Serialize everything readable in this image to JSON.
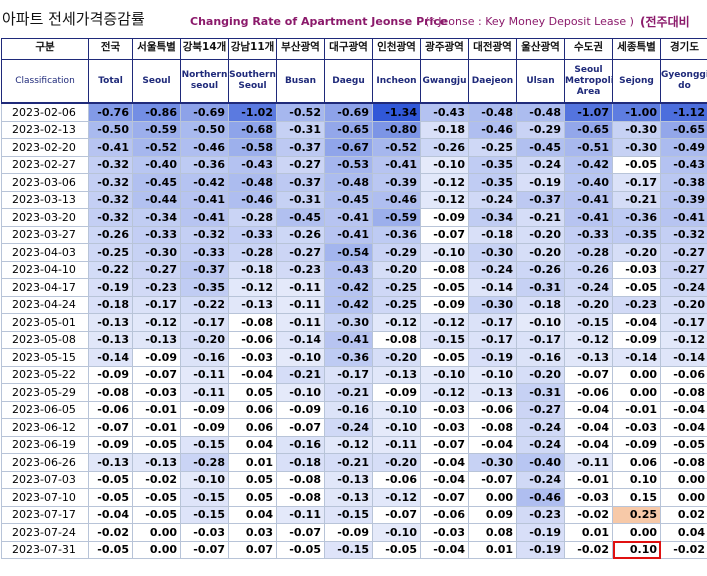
{
  "title": {
    "korean": "아파트 전세가격증감률",
    "english": "Changing Rate of Apartment Jeonse Price",
    "note": "(* Jeonse : Key Money Deposit Lease )",
    "comparison": "(전주대비"
  },
  "header": {
    "corner_korean": "구분",
    "corner_english": "Classification",
    "columns": [
      {
        "ko": "전국",
        "en": "Total"
      },
      {
        "ko": "서울특별",
        "en": "Seoul"
      },
      {
        "ko": "강북14개",
        "en": "Northern seoul"
      },
      {
        "ko": "강남11개",
        "en": "Southern Seoul"
      },
      {
        "ko": "부산광역",
        "en": "Busan"
      },
      {
        "ko": "대구광역",
        "en": "Daegu"
      },
      {
        "ko": "인천광역",
        "en": "Incheon"
      },
      {
        "ko": "광주광역",
        "en": "Gwangju"
      },
      {
        "ko": "대전광역",
        "en": "Daejeon"
      },
      {
        "ko": "울산광역",
        "en": "Ulsan"
      },
      {
        "ko": "수도권",
        "en": "Seoul Metropolitan Area"
      },
      {
        "ko": "세종특별",
        "en": "Sejong"
      },
      {
        "ko": "경기도",
        "en": "Gyeonggi-do"
      }
    ]
  },
  "colors": {
    "header_border": "#1f2a7a",
    "highlight_box": "#e01010",
    "positive_highlight": "#f7c9a8"
  },
  "rows": [
    {
      "date": "2023-02-06",
      "values": [
        "-0.76",
        "-0.86",
        "-0.69",
        "-1.02",
        "-0.52",
        "-0.69",
        "-1.34",
        "-0.43",
        "-0.48",
        "-0.48",
        "-1.07",
        "-1.00",
        "-1.12"
      ]
    },
    {
      "date": "2023-02-13",
      "values": [
        "-0.50",
        "-0.59",
        "-0.50",
        "-0.68",
        "-0.31",
        "-0.65",
        "-0.80",
        "-0.18",
        "-0.46",
        "-0.29",
        "-0.65",
        "-0.30",
        "-0.65"
      ]
    },
    {
      "date": "2023-02-20",
      "values": [
        "-0.41",
        "-0.52",
        "-0.46",
        "-0.58",
        "-0.37",
        "-0.67",
        "-0.52",
        "-0.26",
        "-0.25",
        "-0.45",
        "-0.51",
        "-0.30",
        "-0.49"
      ]
    },
    {
      "date": "2023-02-27",
      "values": [
        "-0.32",
        "-0.40",
        "-0.36",
        "-0.43",
        "-0.27",
        "-0.53",
        "-0.41",
        "-0.10",
        "-0.35",
        "-0.24",
        "-0.42",
        "-0.05",
        "-0.43"
      ]
    },
    {
      "date": "2023-03-06",
      "values": [
        "-0.32",
        "-0.45",
        "-0.42",
        "-0.48",
        "-0.37",
        "-0.48",
        "-0.39",
        "-0.12",
        "-0.35",
        "-0.19",
        "-0.40",
        "-0.17",
        "-0.38"
      ]
    },
    {
      "date": "2023-03-13",
      "values": [
        "-0.32",
        "-0.44",
        "-0.41",
        "-0.46",
        "-0.31",
        "-0.45",
        "-0.46",
        "-0.12",
        "-0.24",
        "-0.37",
        "-0.41",
        "-0.21",
        "-0.39"
      ]
    },
    {
      "date": "2023-03-20",
      "values": [
        "-0.32",
        "-0.34",
        "-0.41",
        "-0.28",
        "-0.45",
        "-0.41",
        "-0.59",
        "-0.09",
        "-0.34",
        "-0.21",
        "-0.41",
        "-0.36",
        "-0.41"
      ]
    },
    {
      "date": "2023-03-27",
      "values": [
        "-0.26",
        "-0.33",
        "-0.32",
        "-0.33",
        "-0.26",
        "-0.41",
        "-0.36",
        "-0.07",
        "-0.18",
        "-0.20",
        "-0.33",
        "-0.35",
        "-0.32"
      ]
    },
    {
      "date": "2023-04-03",
      "values": [
        "-0.25",
        "-0.30",
        "-0.33",
        "-0.28",
        "-0.27",
        "-0.54",
        "-0.29",
        "-0.10",
        "-0.30",
        "-0.20",
        "-0.28",
        "-0.20",
        "-0.27"
      ]
    },
    {
      "date": "2023-04-10",
      "values": [
        "-0.22",
        "-0.27",
        "-0.37",
        "-0.18",
        "-0.23",
        "-0.43",
        "-0.20",
        "-0.08",
        "-0.24",
        "-0.26",
        "-0.26",
        "-0.03",
        "-0.27"
      ]
    },
    {
      "date": "2023-04-17",
      "values": [
        "-0.19",
        "-0.23",
        "-0.35",
        "-0.12",
        "-0.11",
        "-0.42",
        "-0.25",
        "-0.05",
        "-0.14",
        "-0.31",
        "-0.24",
        "-0.05",
        "-0.24"
      ]
    },
    {
      "date": "2023-04-24",
      "values": [
        "-0.18",
        "-0.17",
        "-0.22",
        "-0.13",
        "-0.11",
        "-0.42",
        "-0.25",
        "-0.09",
        "-0.30",
        "-0.18",
        "-0.20",
        "-0.23",
        "-0.20"
      ]
    },
    {
      "date": "2023-05-01",
      "values": [
        "-0.13",
        "-0.12",
        "-0.17",
        "-0.08",
        "-0.11",
        "-0.30",
        "-0.12",
        "-0.12",
        "-0.17",
        "-0.10",
        "-0.15",
        "-0.04",
        "-0.17"
      ]
    },
    {
      "date": "2023-05-08",
      "values": [
        "-0.13",
        "-0.13",
        "-0.20",
        "-0.06",
        "-0.14",
        "-0.41",
        "-0.08",
        "-0.15",
        "-0.17",
        "-0.17",
        "-0.12",
        "-0.09",
        "-0.12"
      ]
    },
    {
      "date": "2023-05-15",
      "values": [
        "-0.14",
        "-0.09",
        "-0.16",
        "-0.03",
        "-0.10",
        "-0.36",
        "-0.20",
        "-0.05",
        "-0.19",
        "-0.16",
        "-0.13",
        "-0.14",
        "-0.14"
      ]
    },
    {
      "date": "2023-05-22",
      "values": [
        "-0.09",
        "-0.07",
        "-0.11",
        "-0.04",
        "-0.21",
        "-0.17",
        "-0.13",
        "-0.10",
        "-0.10",
        "-0.20",
        "-0.07",
        "0.00",
        "-0.06"
      ]
    },
    {
      "date": "2023-05-29",
      "values": [
        "-0.08",
        "-0.03",
        "-0.11",
        "0.05",
        "-0.10",
        "-0.21",
        "-0.09",
        "-0.12",
        "-0.13",
        "-0.31",
        "-0.06",
        "0.00",
        "-0.08"
      ]
    },
    {
      "date": "2023-06-05",
      "values": [
        "-0.06",
        "-0.01",
        "-0.09",
        "0.06",
        "-0.09",
        "-0.16",
        "-0.10",
        "-0.03",
        "-0.06",
        "-0.27",
        "-0.04",
        "-0.01",
        "-0.04"
      ]
    },
    {
      "date": "2023-06-12",
      "values": [
        "-0.07",
        "-0.01",
        "-0.09",
        "0.06",
        "-0.07",
        "-0.24",
        "-0.10",
        "-0.03",
        "-0.08",
        "-0.24",
        "-0.04",
        "-0.03",
        "-0.04"
      ]
    },
    {
      "date": "2023-06-19",
      "values": [
        "-0.09",
        "-0.05",
        "-0.15",
        "0.04",
        "-0.16",
        "-0.12",
        "-0.11",
        "-0.07",
        "-0.04",
        "-0.24",
        "-0.04",
        "-0.09",
        "-0.05"
      ]
    },
    {
      "date": "2023-06-26",
      "values": [
        "-0.13",
        "-0.13",
        "-0.28",
        "0.01",
        "-0.18",
        "-0.21",
        "-0.20",
        "-0.04",
        "-0.30",
        "-0.40",
        "-0.11",
        "0.06",
        "-0.08"
      ]
    },
    {
      "date": "2023-07-03",
      "values": [
        "-0.05",
        "-0.02",
        "-0.10",
        "0.05",
        "-0.08",
        "-0.13",
        "-0.06",
        "-0.04",
        "-0.07",
        "-0.24",
        "-0.01",
        "0.10",
        "0.00"
      ]
    },
    {
      "date": "2023-07-10",
      "values": [
        "-0.05",
        "-0.05",
        "-0.15",
        "0.05",
        "-0.08",
        "-0.13",
        "-0.12",
        "-0.07",
        "0.00",
        "-0.46",
        "-0.03",
        "0.15",
        "0.00"
      ]
    },
    {
      "date": "2023-07-17",
      "values": [
        "-0.04",
        "-0.05",
        "-0.15",
        "0.04",
        "-0.11",
        "-0.15",
        "-0.07",
        "-0.06",
        "0.09",
        "-0.23",
        "-0.02",
        "0.25",
        "0.02"
      ]
    },
    {
      "date": "2023-07-24",
      "values": [
        "-0.02",
        "0.00",
        "-0.03",
        "0.03",
        "-0.07",
        "-0.09",
        "-0.10",
        "-0.03",
        "0.08",
        "-0.19",
        "0.01",
        "0.00",
        "0.04"
      ]
    },
    {
      "date": "2023-07-31",
      "values": [
        "-0.05",
        "0.00",
        "-0.07",
        "0.07",
        "-0.05",
        "-0.15",
        "-0.05",
        "-0.04",
        "0.01",
        "-0.19",
        "-0.02",
        "0.10",
        "-0.02"
      ]
    }
  ],
  "highlight": {
    "row_date": "2023-07-31",
    "column": "Sejong",
    "value": "0.10"
  }
}
